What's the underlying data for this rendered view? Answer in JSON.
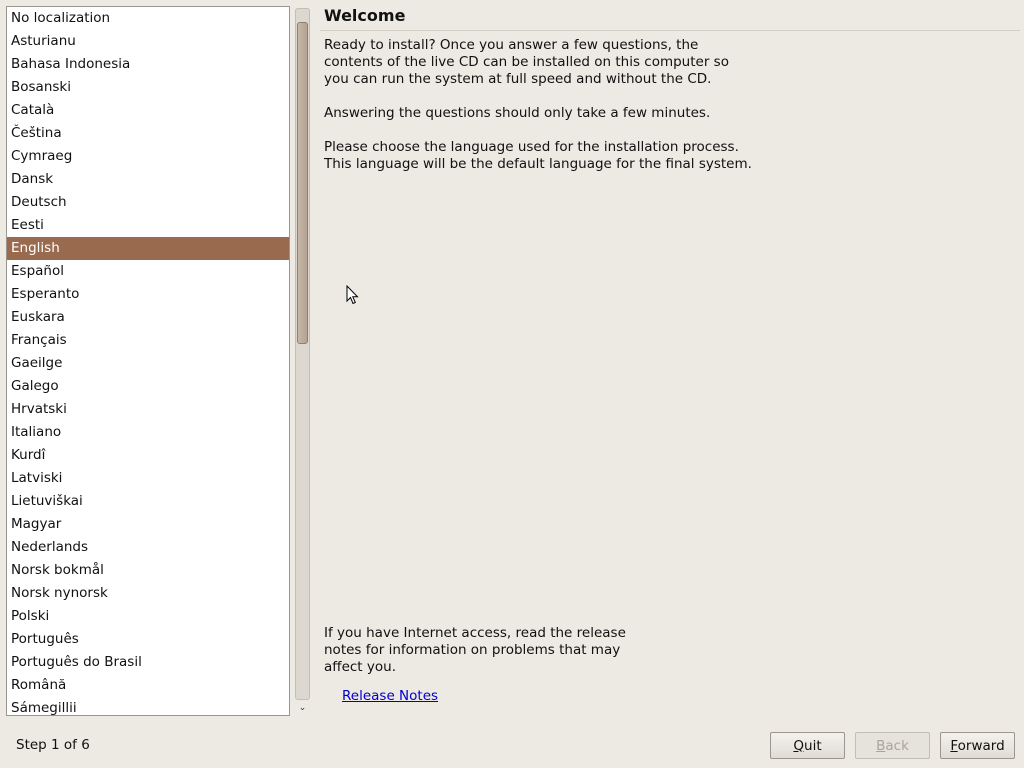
{
  "languages": [
    "No localization",
    "Asturianu",
    "Bahasa Indonesia",
    "Bosanski",
    "Català",
    "Čeština",
    "Cymraeg",
    "Dansk",
    "Deutsch",
    "Eesti",
    "English",
    "Español",
    "Esperanto",
    "Euskara",
    "Français",
    "Gaeilge",
    "Galego",
    "Hrvatski",
    "Italiano",
    "Kurdî",
    "Latviski",
    "Lietuviškai",
    "Magyar",
    "Nederlands",
    "Norsk bokmål",
    "Norsk nynorsk",
    "Polski",
    "Português",
    "Português do Brasil",
    "Română",
    "Sámegillii"
  ],
  "selected_language": "English",
  "scrollbar": {
    "down_arrow": "⌄"
  },
  "welcome": {
    "title": "Welcome",
    "intro": "Ready to install? Once you answer a few questions, the\ncontents of the live CD can be installed on this computer so\nyou can run the system at full speed and without the CD.",
    "duration": "Answering the questions should only take a few minutes.",
    "choose": "Please choose the language used for the installation process.\nThis language will be the default language for the final system.",
    "internet": "If you have Internet access, read the release\nnotes for information on problems that may\naffect you.",
    "release_notes_link": "Release Notes"
  },
  "footer": {
    "step": "Step 1 of 6",
    "quit": "Quit",
    "back": "Back",
    "forward": "Forward"
  },
  "colors": {
    "selection": "#9a6a4e",
    "background": "#ede9e3",
    "link": "#0000cc"
  },
  "icons": {
    "cursor": "mouse-pointer-icon"
  }
}
